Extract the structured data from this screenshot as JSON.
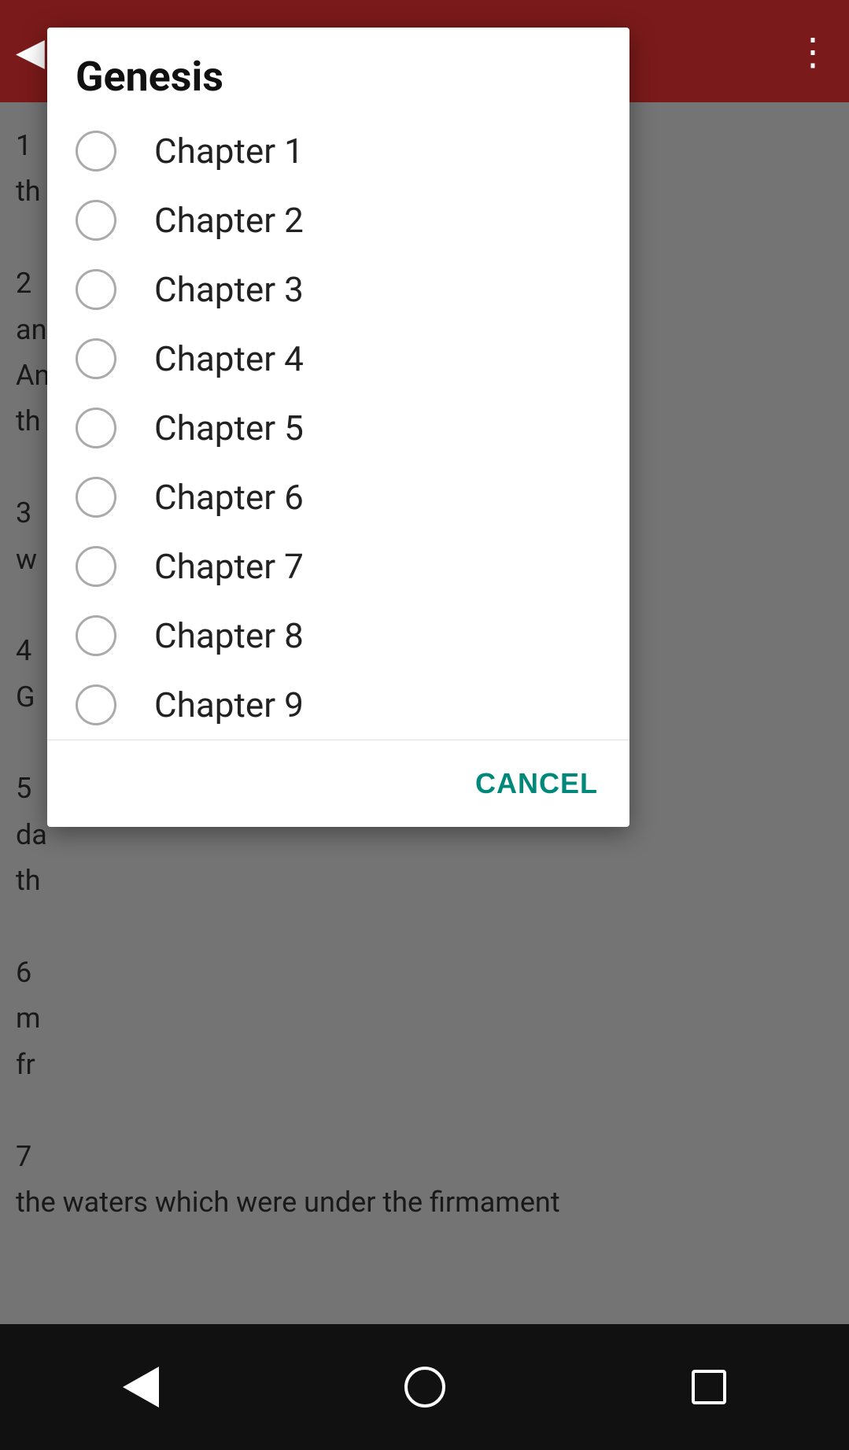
{
  "app": {
    "title": "Genesis"
  },
  "dialog": {
    "title": "Genesis",
    "chapters": [
      {
        "label": "Chapter 1"
      },
      {
        "label": "Chapter 2"
      },
      {
        "label": "Chapter 3"
      },
      {
        "label": "Chapter 4"
      },
      {
        "label": "Chapter 5"
      },
      {
        "label": "Chapter 6"
      },
      {
        "label": "Chapter 7"
      },
      {
        "label": "Chapter 8"
      },
      {
        "label": "Chapter 9"
      }
    ],
    "cancel_label": "CANCEL"
  },
  "background": {
    "lines": [
      "1",
      "th",
      "",
      "2",
      "an",
      "An",
      "th",
      "",
      "3",
      "w",
      "",
      "4",
      "G",
      "",
      "5",
      "da",
      "th",
      "",
      "6",
      "m",
      "fr",
      "",
      "7",
      "the waters which were under the firmament"
    ]
  },
  "nav": {
    "back": "back",
    "home": "home",
    "recents": "recents"
  }
}
